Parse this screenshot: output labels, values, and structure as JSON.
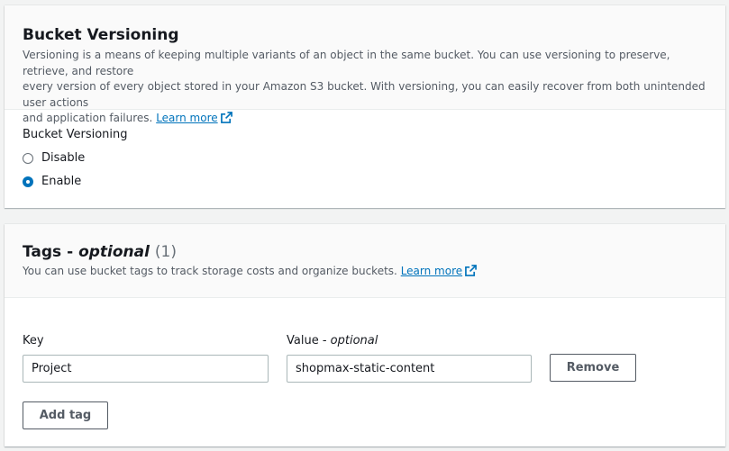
{
  "versioning": {
    "title": "Bucket Versioning",
    "description_line1": "Versioning is a means of keeping multiple variants of an object in the same bucket. You can use versioning to preserve, retrieve, and restore",
    "description_line2": "every version of every object stored in your Amazon S3 bucket. With versioning, you can easily recover from both unintended user actions",
    "description_line3": "and application failures.",
    "learn_more": "Learn more",
    "field_label": "Bucket Versioning",
    "options": [
      {
        "label": "Disable",
        "selected": false
      },
      {
        "label": "Enable",
        "selected": true
      }
    ]
  },
  "tags": {
    "title": "Tags - ",
    "title_optional": "optional",
    "count": "(1)",
    "description": "You can use bucket tags to track storage costs and organize buckets.",
    "learn_more": "Learn more",
    "key_label": "Key",
    "value_label": "Value - ",
    "value_label_optional": "optional",
    "rows": [
      {
        "key": "Project",
        "value": "shopmax-static-content"
      }
    ],
    "remove_label": "Remove",
    "add_tag_label": "Add tag"
  },
  "colors": {
    "link": "#0073bb",
    "radio_selected": "#0073bb",
    "background": "#f2f3f3"
  }
}
